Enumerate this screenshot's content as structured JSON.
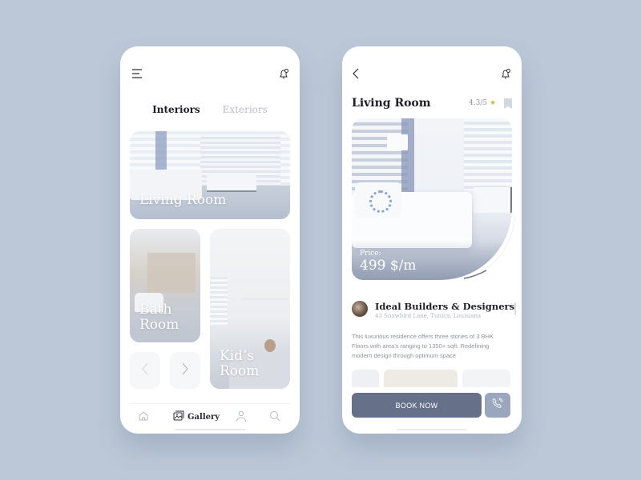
{
  "colors": {
    "background": "#bcc8d8",
    "primary_button": "#677089",
    "secondary_button": "#9aa6bd",
    "rating_star": "#d6b54a",
    "text_dark": "#1e1f24",
    "text_muted": "#8d939c"
  },
  "gallery_screen": {
    "icons": {
      "menu": "menu-icon",
      "notification": "bell-icon"
    },
    "tabs": [
      {
        "label": "Interiors",
        "active": true
      },
      {
        "label": "Exteriors",
        "active": false
      }
    ],
    "cards": [
      {
        "label": "Living Room"
      },
      {
        "label_line1": "Bath",
        "label_line2": "Room"
      },
      {
        "label_line1": "Kid’s",
        "label_line2": "Room"
      }
    ],
    "carousel": {
      "prev": "chevron-left-icon",
      "next": "chevron-right-icon"
    },
    "bottom_nav": [
      {
        "icon": "home-icon",
        "label": ""
      },
      {
        "icon": "gallery-icon",
        "label": "Gallery",
        "active": true
      },
      {
        "icon": "profile-icon",
        "label": ""
      },
      {
        "icon": "search-icon",
        "label": ""
      }
    ]
  },
  "detail_screen": {
    "icons": {
      "back": "back-arrow-icon",
      "notification": "bell-icon",
      "bookmark": "bookmark-icon"
    },
    "title": "Living Room",
    "rating": "4.3/5",
    "rating_star": "★",
    "price_label": "Price:",
    "price_value": "499 $/m",
    "builder": {
      "name": "Ideal Builders & Designers",
      "address": "43  Snowbird Lane, Tunica, Louisiana"
    },
    "description": "This luxurious residence offers three stories of 3 BHK Floors with area's ranging to 1350+ sqft. Redefining modern design through optimum space",
    "book_button": "BOOK NOW",
    "call_icon": "phone-icon"
  }
}
